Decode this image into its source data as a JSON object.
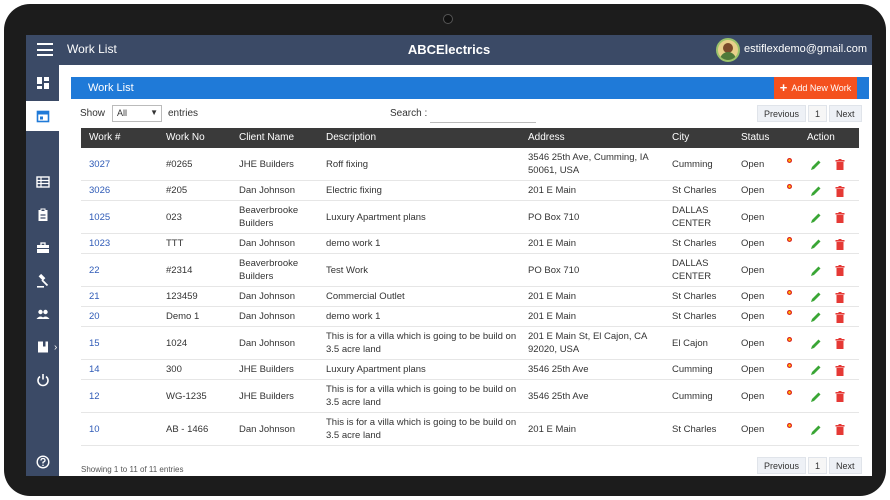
{
  "header": {
    "app_title": "Work List",
    "brand": "ABCElectrics",
    "user_email": "estiflexdemo@gmail.com"
  },
  "panel": {
    "title": "Work List",
    "add_button": "Add New Work"
  },
  "controls": {
    "show_label": "Show",
    "show_value": "All",
    "entries_label": "entries",
    "search_label": "Search :",
    "search_value": "",
    "pager_prev": "Previous",
    "pager_page": "1",
    "pager_next": "Next"
  },
  "table": {
    "columns": [
      "Work #",
      "Work No",
      "Client Name",
      "Description",
      "Address",
      "City",
      "Status",
      "Action"
    ],
    "rows": [
      {
        "id": "3027",
        "no": "#0265",
        "client": [
          "JHE Builders"
        ],
        "desc": [
          "Roff fixing"
        ],
        "addr": [
          "3546 25th Ave, Cumming, IA",
          "50061, USA"
        ],
        "city": [
          "Cumming"
        ],
        "status": "Open",
        "dot": true
      },
      {
        "id": "3026",
        "no": "#205",
        "client": [
          "Dan Johnson"
        ],
        "desc": [
          "Electric fixing"
        ],
        "addr": [
          "201 E Main"
        ],
        "city": [
          "St Charles"
        ],
        "status": "Open",
        "dot": true
      },
      {
        "id": "1025",
        "no": "023",
        "client": [
          "Beaverbrooke",
          "Builders"
        ],
        "desc": [
          "Luxury Apartment plans"
        ],
        "addr": [
          "PO Box 710"
        ],
        "city": [
          "DALLAS",
          "CENTER"
        ],
        "status": "Open",
        "dot": false
      },
      {
        "id": "1023",
        "no": "TTT",
        "client": [
          "Dan Johnson"
        ],
        "desc": [
          "demo work 1"
        ],
        "addr": [
          "201 E Main"
        ],
        "city": [
          "St Charles"
        ],
        "status": "Open",
        "dot": true
      },
      {
        "id": "22",
        "no": "#2314",
        "client": [
          "Beaverbrooke",
          "Builders"
        ],
        "desc": [
          "Test Work"
        ],
        "addr": [
          "PO Box 710"
        ],
        "city": [
          "DALLAS",
          "CENTER"
        ],
        "status": "Open",
        "dot": false
      },
      {
        "id": "21",
        "no": "123459",
        "client": [
          "Dan Johnson"
        ],
        "desc": [
          "Commercial Outlet"
        ],
        "addr": [
          "201 E Main"
        ],
        "city": [
          "St Charles"
        ],
        "status": "Open",
        "dot": true
      },
      {
        "id": "20",
        "no": "Demo 1",
        "client": [
          "Dan Johnson"
        ],
        "desc": [
          "demo work 1"
        ],
        "addr": [
          "201 E Main"
        ],
        "city": [
          "St Charles"
        ],
        "status": "Open",
        "dot": true
      },
      {
        "id": "15",
        "no": "1024",
        "client": [
          "Dan Johnson"
        ],
        "desc": [
          "This is for a villa which is going to be build on",
          "3.5 acre land"
        ],
        "addr": [
          "201 E Main St, El Cajon, CA",
          "92020, USA"
        ],
        "city": [
          "El Cajon"
        ],
        "status": "Open",
        "dot": true
      },
      {
        "id": "14",
        "no": "300",
        "client": [
          "JHE Builders"
        ],
        "desc": [
          "Luxury Apartment plans"
        ],
        "addr": [
          "3546 25th Ave"
        ],
        "city": [
          "Cumming"
        ],
        "status": "Open",
        "dot": true
      },
      {
        "id": "12",
        "no": "WG-1235",
        "client": [
          "JHE Builders"
        ],
        "desc": [
          "This is for a villa which is going to be build on",
          "3.5 acre land"
        ],
        "addr": [
          "3546 25th Ave"
        ],
        "city": [
          "Cumming"
        ],
        "status": "Open",
        "dot": true
      },
      {
        "id": "10",
        "no": "AB - 1466",
        "client": [
          "Dan Johnson"
        ],
        "desc": [
          "This is for a villa which is going to be build on",
          "3.5 acre land"
        ],
        "addr": [
          "201 E Main"
        ],
        "city": [
          "St Charles"
        ],
        "status": "Open",
        "dot": true
      }
    ]
  },
  "footer": {
    "info": "Showing 1 to 11 of 11 entries"
  },
  "sidebar": {
    "icons": [
      "dashboard-icon",
      "calendar-icon",
      "list-icon",
      "clipboard-icon",
      "briefcase-icon",
      "gavel-icon",
      "people-icon",
      "book-icon",
      "power-icon",
      "help-icon"
    ]
  },
  "colors": {
    "topbar": "#3b4a66",
    "panel_header": "#1f7ad8",
    "add_button": "#f4511e",
    "table_header": "#3a3a3a",
    "link": "#2f5bb7",
    "edit": "#3aa635",
    "delete": "#e53935"
  }
}
